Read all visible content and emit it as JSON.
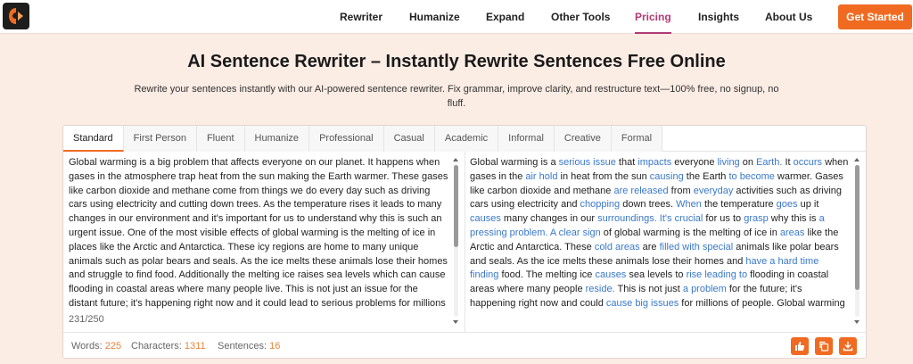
{
  "nav": {
    "links": [
      "Rewriter",
      "Humanize",
      "Expand",
      "Other Tools",
      "Pricing",
      "Insights",
      "About Us"
    ],
    "active": "Pricing",
    "cta": "Get Started"
  },
  "hero": {
    "title": "AI Sentence Rewriter – Instantly Rewrite Sentences Free Online",
    "subtitle": "Rewrite your sentences instantly with our AI-powered sentence rewriter. Fix grammar, improve clarity, and restructure text—100% free, no signup, no fluff."
  },
  "tabs": [
    "Standard",
    "First Person",
    "Fluent",
    "Humanize",
    "Professional",
    "Casual",
    "Academic",
    "Informal",
    "Creative",
    "Formal"
  ],
  "active_tab": "Standard",
  "input_text": "Global warming is a big problem that affects everyone on our planet. It happens when gases in the atmosphere trap heat from the sun making the Earth warmer. These gases like carbon dioxide and methane come from things we do every day such as driving cars using electricity and cutting down trees. As the temperature rises it leads to many changes in our environment and it's important for us to understand why this is such an urgent issue. One of the most visible effects of global warming is the melting of ice in places like the Arctic and Antarctica. These icy regions are home to many unique animals such as polar bears and seals. As the ice melts these animals lose their homes and struggle to find food. Additionally the melting ice raises sea levels which can cause flooding in coastal areas where many people live. This is not just an issue for the distant future; it's happening right now and it could lead to serious problems for millions",
  "output_segments": [
    {
      "t": "Global warming is a ",
      "h": false
    },
    {
      "t": "serious issue",
      "h": true
    },
    {
      "t": " that ",
      "h": false
    },
    {
      "t": "impacts",
      "h": true
    },
    {
      "t": " everyone ",
      "h": false
    },
    {
      "t": "living",
      "h": true
    },
    {
      "t": " on ",
      "h": false
    },
    {
      "t": "Earth.",
      "h": true
    },
    {
      "t": " It ",
      "h": false
    },
    {
      "t": "occurs",
      "h": true
    },
    {
      "t": " when gases in the ",
      "h": false
    },
    {
      "t": "air hold",
      "h": true
    },
    {
      "t": " in heat from the sun ",
      "h": false
    },
    {
      "t": "causing",
      "h": true
    },
    {
      "t": " the Earth ",
      "h": false
    },
    {
      "t": "to become",
      "h": true
    },
    {
      "t": " warmer. Gases like carbon dioxide and methane ",
      "h": false
    },
    {
      "t": "are released",
      "h": true
    },
    {
      "t": " from ",
      "h": false
    },
    {
      "t": "everyday",
      "h": true
    },
    {
      "t": " activities such as driving cars using electricity and ",
      "h": false
    },
    {
      "t": "chopping",
      "h": true
    },
    {
      "t": " down trees. ",
      "h": false
    },
    {
      "t": "When",
      "h": true
    },
    {
      "t": " the temperature ",
      "h": false
    },
    {
      "t": "goes",
      "h": true
    },
    {
      "t": " up it ",
      "h": false
    },
    {
      "t": "causes",
      "h": true
    },
    {
      "t": " many changes in our ",
      "h": false
    },
    {
      "t": "surroundings. It's crucial",
      "h": true
    },
    {
      "t": " for us to ",
      "h": false
    },
    {
      "t": "grasp",
      "h": true
    },
    {
      "t": " why this is ",
      "h": false
    },
    {
      "t": "a pressing problem. A clear sign",
      "h": true
    },
    {
      "t": " of global warming is the melting of ice in ",
      "h": false
    },
    {
      "t": "areas",
      "h": true
    },
    {
      "t": " like the Arctic and Antarctica. These ",
      "h": false
    },
    {
      "t": "cold areas",
      "h": true
    },
    {
      "t": " are ",
      "h": false
    },
    {
      "t": "filled with special",
      "h": true
    },
    {
      "t": " animals like polar bears and seals. As the ice melts these animals lose their homes and ",
      "h": false
    },
    {
      "t": "have a hard time finding",
      "h": true
    },
    {
      "t": " food. The melting ice ",
      "h": false
    },
    {
      "t": "causes",
      "h": true
    },
    {
      "t": " sea levels to ",
      "h": false
    },
    {
      "t": "rise leading to",
      "h": true
    },
    {
      "t": " flooding in coastal areas where many people ",
      "h": false
    },
    {
      "t": "reside.",
      "h": true
    },
    {
      "t": " This is not just ",
      "h": false
    },
    {
      "t": "a problem",
      "h": true
    },
    {
      "t": " for the future; it's happening right now and could ",
      "h": false
    },
    {
      "t": "cause big issues",
      "h": true
    },
    {
      "t": " for millions of people. Global warming",
      "h": false
    }
  ],
  "char_count": "231/250",
  "stats": {
    "words_label": "Words:",
    "words": "225",
    "characters_label": "Characters:",
    "characters": "1311",
    "sentences_label": "Sentences:",
    "sentences": "16"
  },
  "icons": {
    "like": "thumbs-up-icon",
    "copy": "copy-icon",
    "download": "download-icon"
  },
  "colors": {
    "accent": "#f06b21",
    "active_nav": "#b23a74",
    "highlight": "#3a78c8",
    "background": "#fbece4"
  }
}
